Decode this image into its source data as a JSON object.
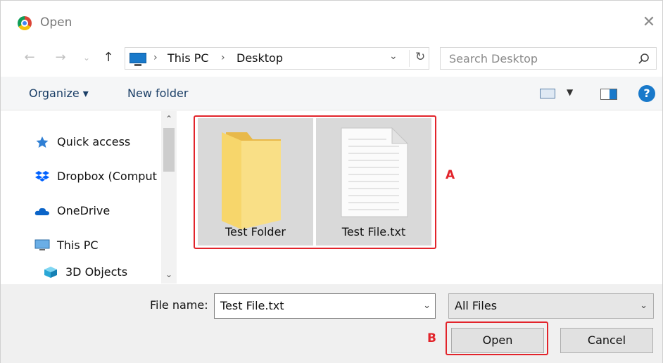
{
  "window": {
    "title": "Open",
    "close_glyph": "✕"
  },
  "nav": {
    "back_glyph": "←",
    "forward_glyph": "→",
    "recent_glyph": "⌄",
    "up_glyph": "↑",
    "breadcrumbs": [
      "This PC",
      "Desktop"
    ],
    "separator": "›",
    "dropdown_glyph": "⌄",
    "refresh_glyph": "↻",
    "search_placeholder": "Search Desktop"
  },
  "toolbar": {
    "organize_label": "Organize ▾",
    "new_folder_label": "New folder",
    "view_dropdown_glyph": "▼",
    "help_glyph": "?"
  },
  "sidebar": {
    "items": [
      {
        "label": "Quick access",
        "icon": "star-icon"
      },
      {
        "label": "Dropbox (Comput",
        "icon": "dropbox-icon"
      },
      {
        "label": "OneDrive",
        "icon": "cloud-icon"
      },
      {
        "label": "This PC",
        "icon": "computer-icon"
      },
      {
        "label": "3D Objects",
        "icon": "cube-icon"
      }
    ],
    "scroll_up_glyph": "⌃",
    "scroll_down_glyph": "⌄"
  },
  "files": [
    {
      "name": "Test Folder",
      "type": "folder"
    },
    {
      "name": "Test File.txt",
      "type": "text-file"
    }
  ],
  "annotations": {
    "a": "A",
    "b": "B"
  },
  "footer": {
    "file_name_label": "File name:",
    "file_name_value": "Test File.txt",
    "filter_value": "All Files",
    "dropdown_glyph": "⌄",
    "open_label": "Open",
    "cancel_label": "Cancel"
  },
  "colors": {
    "accent": "#1979ca",
    "highlight": "#e2242b",
    "folder": "#f7d66b"
  }
}
